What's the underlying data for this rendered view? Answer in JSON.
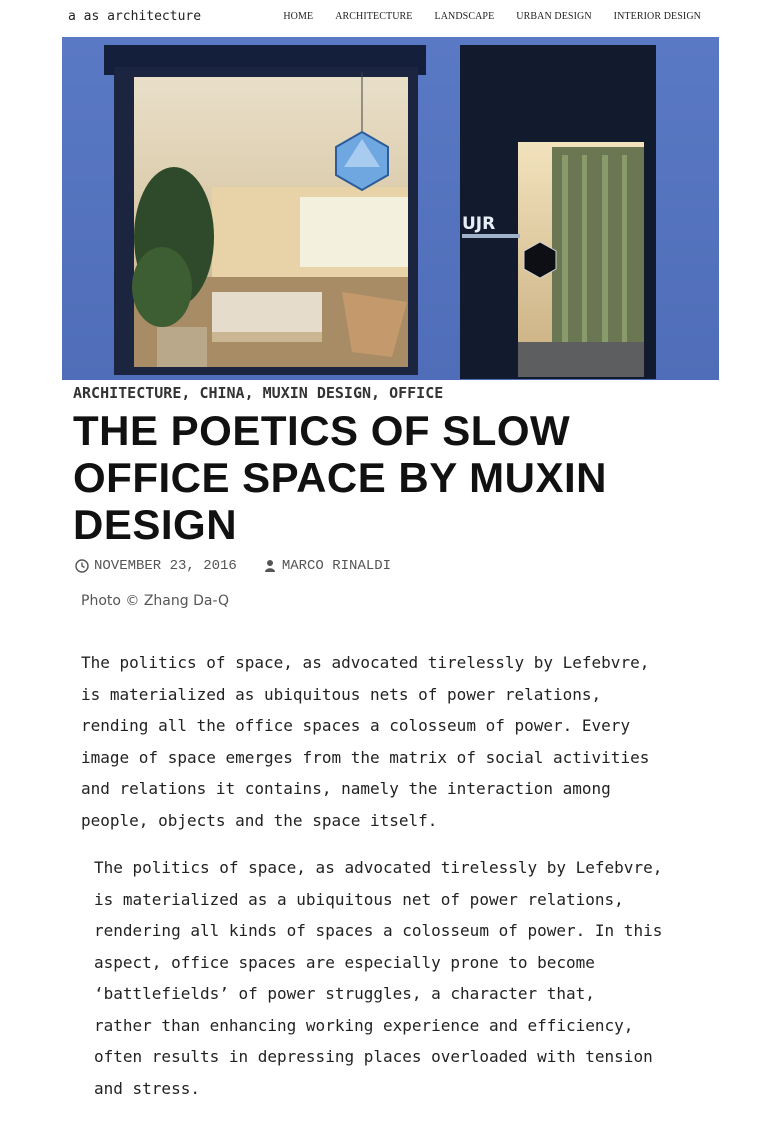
{
  "site": {
    "title": "a as architecture"
  },
  "nav": {
    "items": [
      "HOME",
      "ARCHITECTURE",
      "LANDSCAPE",
      "URBAN DESIGN",
      "INTERIOR DESIGN"
    ]
  },
  "hero": {
    "logo_text": "UJR"
  },
  "post": {
    "categories": [
      "ARCHITECTURE",
      "CHINA",
      "MUXIN DESIGN",
      "OFFICE"
    ],
    "category_separator": ",",
    "title": "THE POETICS OF SLOW OFFICE SPACE BY MUXIN DESIGN",
    "date": "NOVEMBER 23, 2016",
    "author": "MARCO RINALDI",
    "photo_credit": "Photo © Zhang Da-Q",
    "paragraphs": [
      "The politics of space, as advocated tirelessly by Lefebvre,\nis materialized as ubiquitous nets of power relations,\nrending all the office spaces a colosseum of power. Every\nimage of space emerges from the matrix of social activities\nand relations it contains, namely the interaction among\npeople, objects and the space itself.",
      "The politics of space, as advocated tirelessly by Lefebvre,\nis materialized as a ubiquitous net of power relations,\nrendering all kinds of spaces a colosseum of power. In this\naspect, office spaces are especially prone to become\n‘battlefields’ of power struggles, a character that,\nrather than enhancing working experience and efficiency,\noften results in depressing places overloaded with tension\nand stress."
    ]
  },
  "icons": {
    "date": "clock-icon",
    "author": "user-icon"
  }
}
